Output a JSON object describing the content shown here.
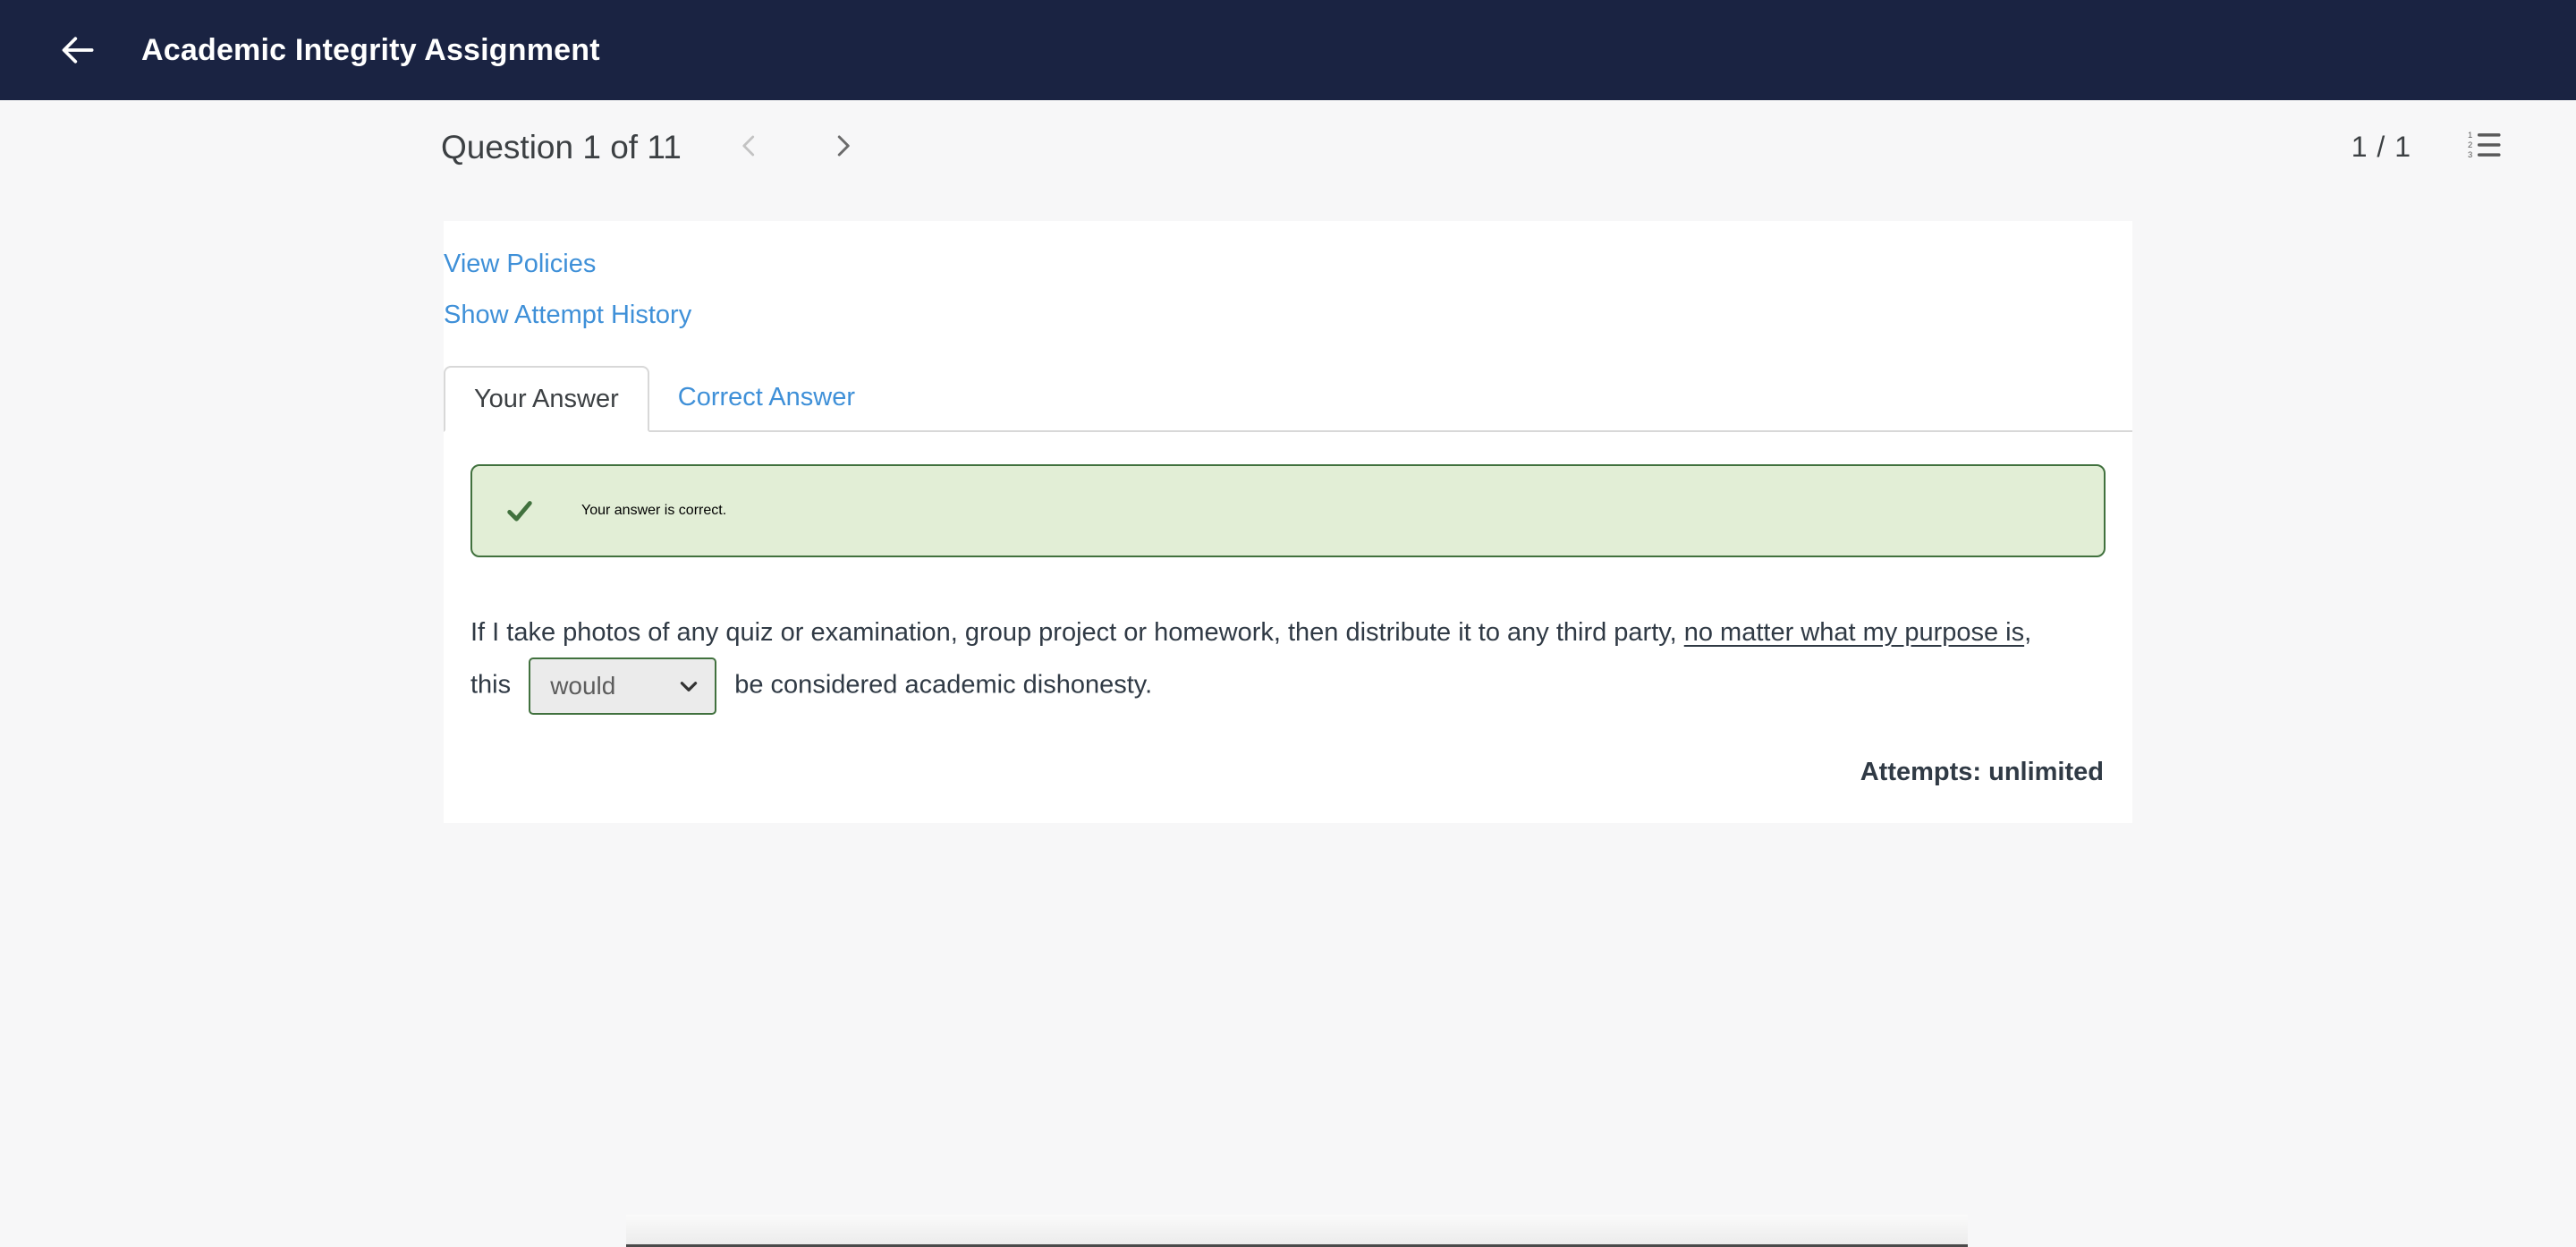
{
  "appbar": {
    "back_icon": "arrow-left-icon",
    "title": "Academic Integrity Assignment"
  },
  "question_nav": {
    "title": "Question 1 of 11",
    "prev_icon": "chevron-left-icon",
    "next_icon": "chevron-right-icon",
    "prev_enabled": "false",
    "next_enabled": "true",
    "page_count": "1 / 1",
    "list_icon": "numbered-list-icon"
  },
  "card": {
    "links": [
      {
        "label": "View Policies",
        "name": "view-policies-link"
      },
      {
        "label": "Show Attempt History",
        "name": "show-attempt-history-link"
      }
    ],
    "tabs": [
      {
        "label": "Your Answer",
        "active": "true"
      },
      {
        "label": "Correct Answer",
        "active": "false"
      }
    ],
    "alert": {
      "icon": "checkmark-icon",
      "text": "Your answer is correct.",
      "bg_color": "#e2eed6",
      "border_color": "#41713e",
      "text_color": "#41713e"
    },
    "question": {
      "part1": "If I take photos of any quiz or examination, group project or homework, then distribute it to any third party, ",
      "underlined": "no matter what my purpose is",
      "part2": ", this ",
      "part3": " be considered academic dishonesty."
    },
    "answer_select": {
      "value": "would",
      "caret_icon": "chevron-down-icon",
      "border_color": "#41713e",
      "background_color": "#ebebeb"
    },
    "attempts": "Attempts: unlimited"
  },
  "colors": {
    "appbar_bg": "#1a2342",
    "page_bg": "#f7f7f8",
    "card_bg": "#ffffff",
    "link_blue": "#3f90d8",
    "text_dark": "#303a45"
  }
}
